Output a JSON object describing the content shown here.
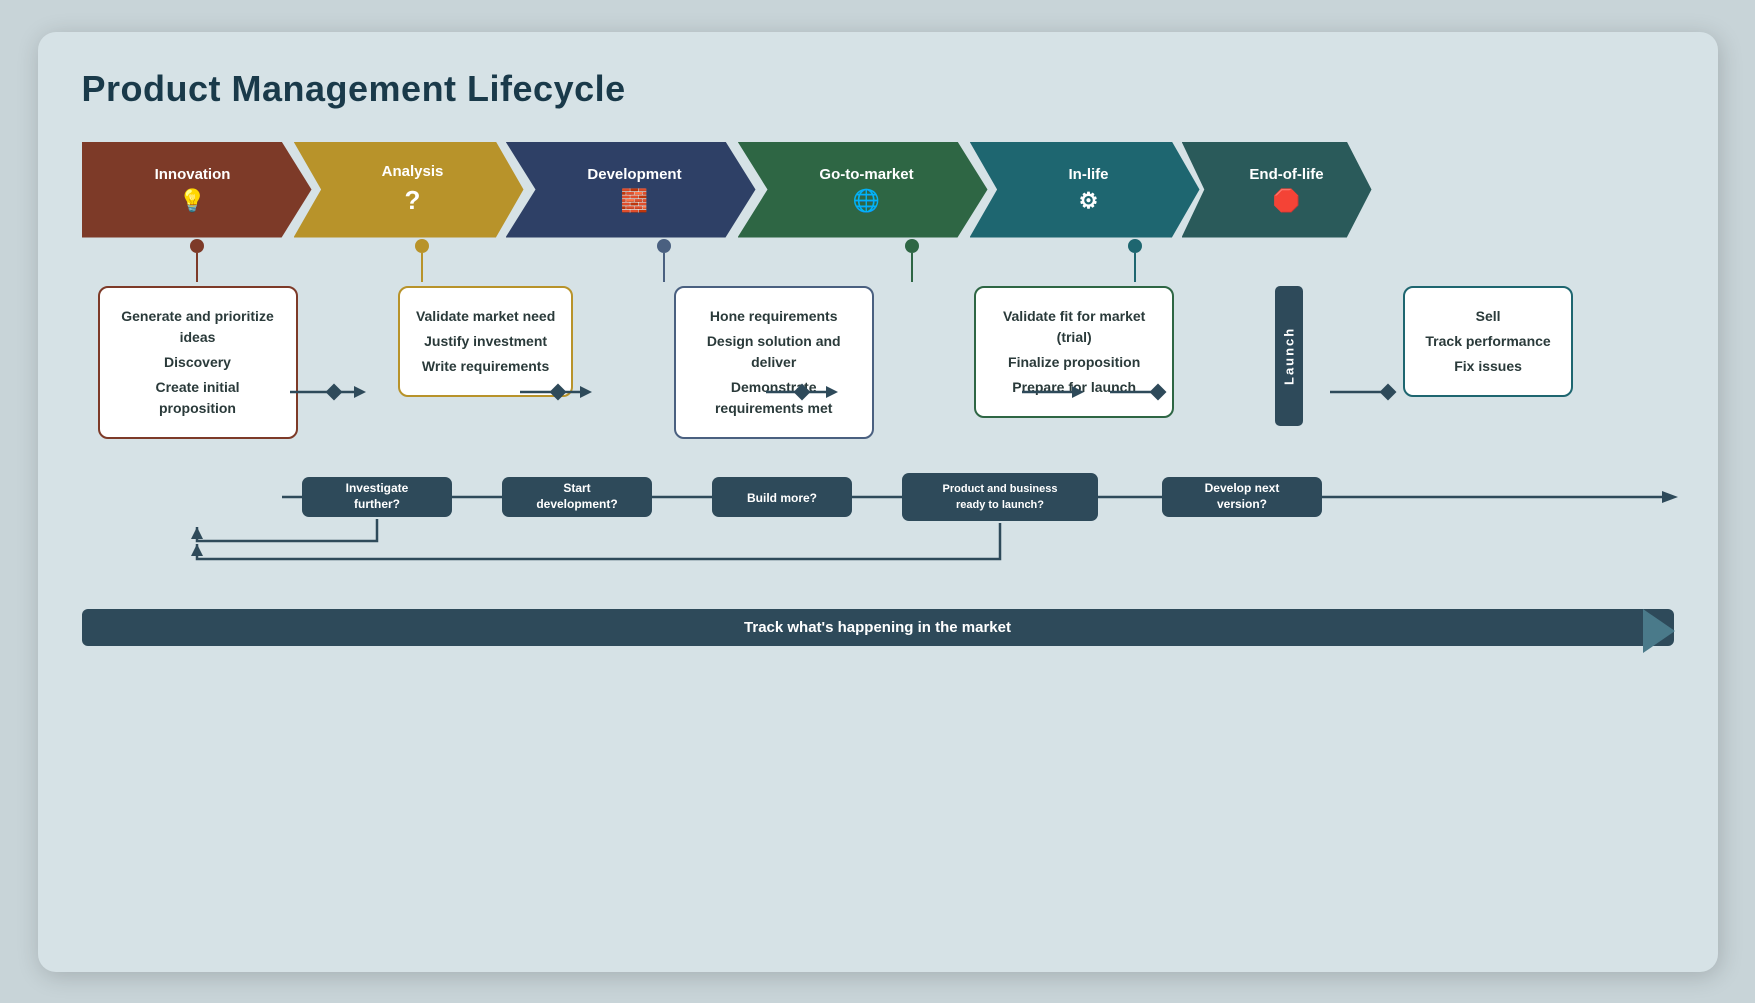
{
  "title": "Product Management Lifecycle",
  "arrows": [
    {
      "id": "innovation",
      "label": "Innovation",
      "icon": "💡",
      "color": "#7d3a28",
      "isFirst": true
    },
    {
      "id": "analysis",
      "label": "Analysis",
      "icon": "?",
      "color": "#b8932a",
      "isFirst": false
    },
    {
      "id": "development",
      "label": "Development",
      "icon": "☰",
      "color": "#2e4066",
      "isFirst": false
    },
    {
      "id": "gtm",
      "label": "Go-to-market",
      "icon": "🌐",
      "color": "#2e6644",
      "isFirst": false
    },
    {
      "id": "inlife",
      "label": "In-life",
      "icon": "⚙",
      "color": "#1e6670",
      "isFirst": false
    },
    {
      "id": "eol",
      "label": "End-of-life",
      "icon": "⛔",
      "color": "#2a5a5a",
      "isLast": true
    }
  ],
  "cards": [
    {
      "id": "innovation-card",
      "borderColor": "#7d3a28",
      "dotColor": "#7d3a28",
      "items": [
        "Generate and prioritize ideas",
        "Discovery",
        "Create initial proposition"
      ]
    },
    {
      "id": "analysis-card",
      "borderColor": "#b8932a",
      "dotColor": "#b8932a",
      "items": [
        "Validate market need",
        "Justify investment",
        "Write requirements"
      ]
    },
    {
      "id": "development-card",
      "borderColor": "#4a6080",
      "dotColor": "#4a6080",
      "items": [
        "Hone requirements",
        "Design solution and deliver",
        "Demonstrate requirements met"
      ]
    },
    {
      "id": "gtm-card",
      "borderColor": "#2e6644",
      "dotColor": "#2e6644",
      "items": [
        "Validate fit for market (trial)",
        "Finalize proposition",
        "Prepare for launch"
      ]
    },
    {
      "id": "inlife-card",
      "borderColor": "#1e6670",
      "dotColor": "#1e6670",
      "items": [
        "Sell",
        "Track performance",
        "Fix issues"
      ]
    }
  ],
  "launch_label": "Launch",
  "decisions": [
    "Investigate further?",
    "Start development?",
    "Build more?",
    "Product and business ready to launch?",
    "Develop next version?"
  ],
  "track_label": "Track what's happening in the market"
}
